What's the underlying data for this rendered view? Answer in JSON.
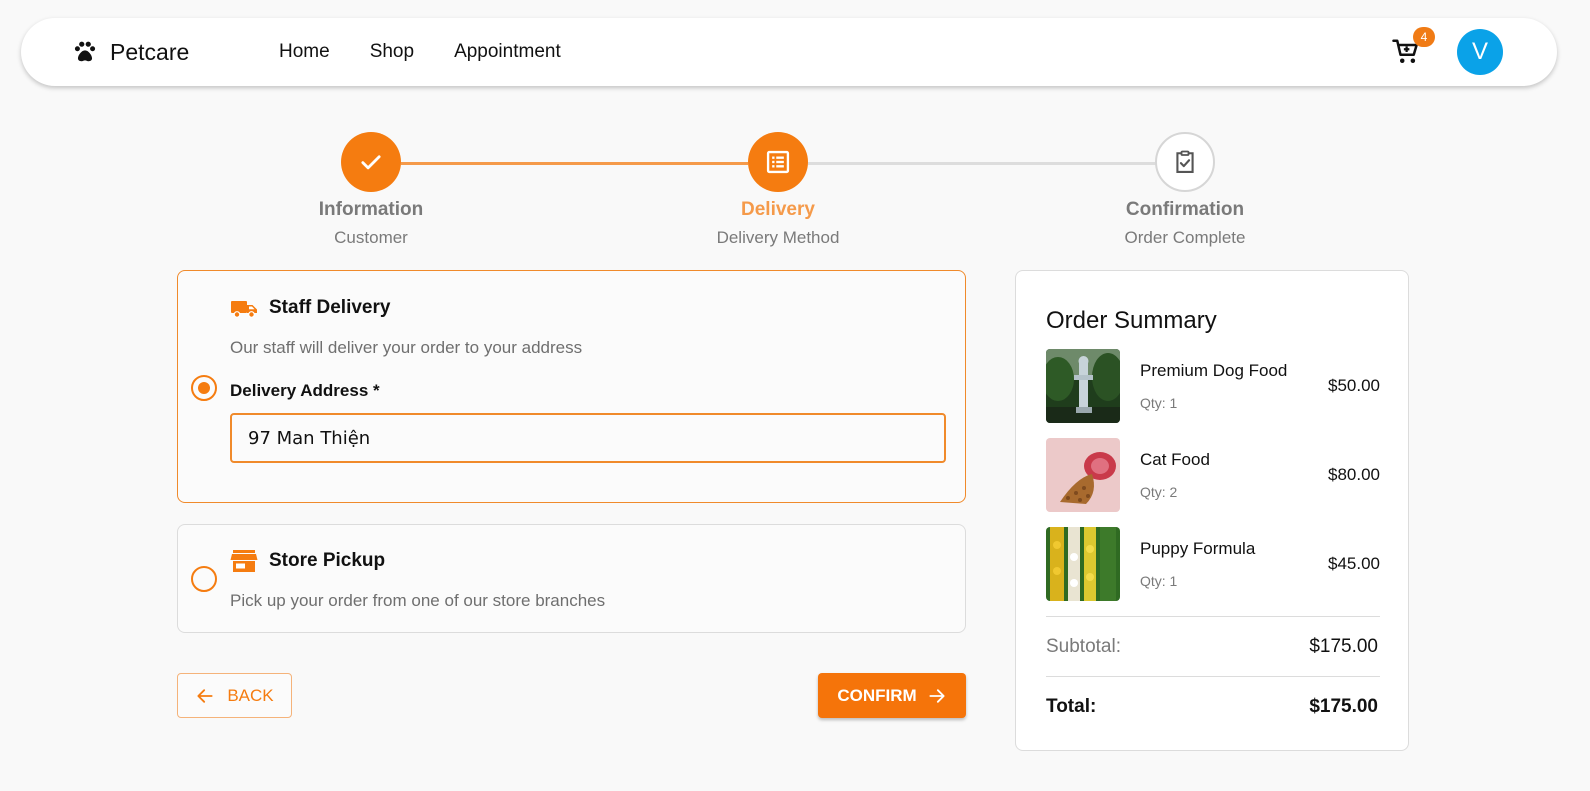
{
  "navbar": {
    "brand": "Petcare",
    "brand_icon": "paw-icon",
    "links": [
      "Home",
      "Shop",
      "Appointment"
    ],
    "cart_count": "4",
    "avatar_initial": "V"
  },
  "stepper": {
    "steps": [
      {
        "title": "Information",
        "subtitle": "Customer",
        "state": "done",
        "icon": "check-icon"
      },
      {
        "title": "Delivery",
        "subtitle": "Delivery Method",
        "state": "active",
        "icon": "list-icon"
      },
      {
        "title": "Confirmation",
        "subtitle": "Order Complete",
        "state": "pending",
        "icon": "clipboard-check-icon"
      }
    ]
  },
  "delivery": {
    "staff": {
      "title": "Staff Delivery",
      "description": "Our staff will deliver your order to your address",
      "address_label": "Delivery Address *",
      "address_value": "97 Man Thiện",
      "selected": true,
      "icon": "truck-icon"
    },
    "pickup": {
      "title": "Store Pickup",
      "description": "Pick up your order from one of our store branches",
      "selected": false,
      "icon": "store-icon"
    }
  },
  "actions": {
    "back": "BACK",
    "confirm": "CONFIRM"
  },
  "summary": {
    "title": "Order Summary",
    "items": [
      {
        "name": "Premium Dog Food",
        "qty": "Qty: 1",
        "price": "$50.00"
      },
      {
        "name": "Cat Food",
        "qty": "Qty: 2",
        "price": "$80.00"
      },
      {
        "name": "Puppy Formula",
        "qty": "Qty: 1",
        "price": "$45.00"
      }
    ],
    "subtotal_label": "Subtotal:",
    "subtotal_value": "$175.00",
    "total_label": "Total:",
    "total_value": "$175.00"
  },
  "colors": {
    "accent": "#f57c10",
    "accent_light": "#f59a4a",
    "avatar": "#0aa2e8",
    "background": "#f9f9f9"
  }
}
